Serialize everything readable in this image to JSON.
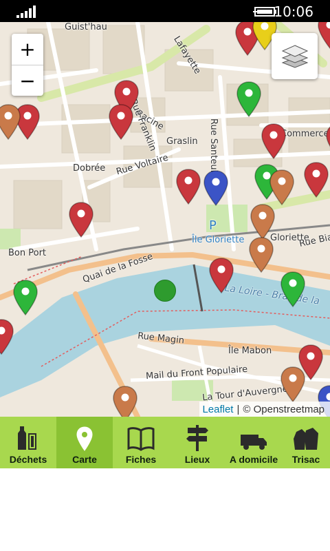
{
  "status_bar": {
    "time": "10:06"
  },
  "map": {
    "zoom_in_label": "+",
    "zoom_out_label": "−",
    "labels": {
      "guisthau": "Guist'hau",
      "lafayette": "Lafayette",
      "racine": "Racine",
      "franklin": "Rue Franklin",
      "graslin": "Graslin",
      "commerce": "Commerce",
      "santeuil": "Rue Santeuil",
      "dobree": "Dobrée",
      "voltaire": "Rue Voltaire",
      "gloriette_poi": "Île Gloriette",
      "gloriette": "Gloriette",
      "rue_bia": "Rue Bia",
      "bon_port": "Bon Port",
      "quai_fosse": "Quai de la Fosse",
      "loire": "La Loire - Bras de la",
      "rue_magin": "Rue Magin",
      "ile_mabon": "Île Mabon",
      "mail_front": "Mail du Front Populaire",
      "tour_auvergne": "La Tour d'Auvergne",
      "parking": "P"
    },
    "attribution": {
      "link": "Leaflet",
      "separator": "|",
      "text": "© Openstreetmap"
    },
    "marker_colors": {
      "red": "#c9373d",
      "green": "#2db63a",
      "brown": "#c97a4a",
      "blue": "#3b54c6",
      "yellow": "#e8cf1a"
    }
  },
  "tabs": [
    {
      "label": "Déchets",
      "icon": "bottles-icon",
      "active": false
    },
    {
      "label": "Carte",
      "icon": "map-pin-icon",
      "active": true
    },
    {
      "label": "Fiches",
      "icon": "book-icon",
      "active": false
    },
    {
      "label": "Lieux",
      "icon": "signpost-icon",
      "active": false
    },
    {
      "label": "A domicile",
      "icon": "truck-icon",
      "active": false
    },
    {
      "label": "Trisac",
      "icon": "bags-icon",
      "active": false
    }
  ],
  "colors": {
    "tabbar": "#a8d84e",
    "tab_active": "#8ac233"
  }
}
